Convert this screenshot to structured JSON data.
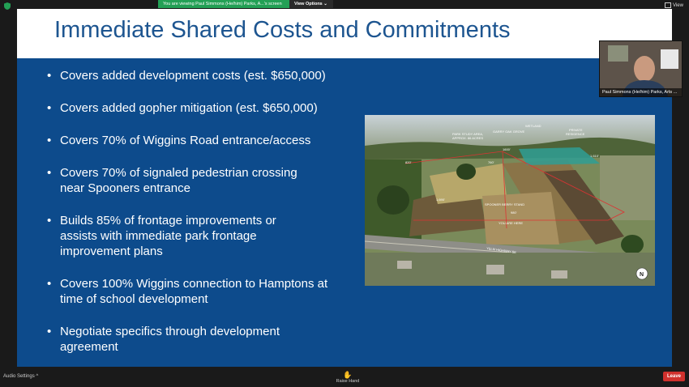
{
  "zoom": {
    "viewing_banner": "You are viewing Paul Simmons (He/him) Parks, A...'s screen",
    "view_options_label": "View Options",
    "view_label": "View",
    "audio_settings_label": "Audio Settings",
    "raise_hand_label": "Raise Hand",
    "leave_label": "Leave",
    "participant_name": "Paul Simmons (He/him) Parks, Arts ...",
    "colors": {
      "banner": "#23a055",
      "leave": "#d0312d",
      "bar": "#1a1a1a"
    }
  },
  "slide": {
    "title": "Immediate Shared Costs and Commitments",
    "bullets": [
      [
        "Covers added development costs (est. $650,000)"
      ],
      [
        "Covers added gopher mitigation (est. $650,000)"
      ],
      [
        "Covers 70% of Wiggins Road entrance/access"
      ],
      [
        "Covers 70% of signaled pedestrian crossing",
        "near Spooners entrance"
      ],
      [
        "Builds 85% of frontage improvements or",
        "assists with immediate park frontage",
        "improvement plans"
      ],
      [
        "Covers 100% Wiggins connection to Hamptons at",
        "time of school development"
      ],
      [
        "Negotiate specifics through development",
        "agreement"
      ]
    ],
    "map_labels": {
      "wetland": "WETLAND",
      "park_study_area": "PARK STUDY AREA,",
      "park_study_area_2": "APPROX. 86 ACRES",
      "garry_oak": "GARRY OAK GROVE",
      "private_residence": "PRIVATE",
      "private_residence_2": "RESIDENCE",
      "spooner": "SPOONER BERRY STAND",
      "you_are_here": "YOU ARE HERE",
      "highway": "YELM HIGHWAY SE",
      "north": "N",
      "dim_1": "1600'",
      "dim_2": "760'",
      "dim_3": "980'",
      "dim_4": "1,610'",
      "dim_5": "1,690'",
      "dim_6": "820'"
    },
    "colors": {
      "background": "#0d4b8c",
      "header": "#ffffff",
      "title": "#1d5590"
    }
  }
}
